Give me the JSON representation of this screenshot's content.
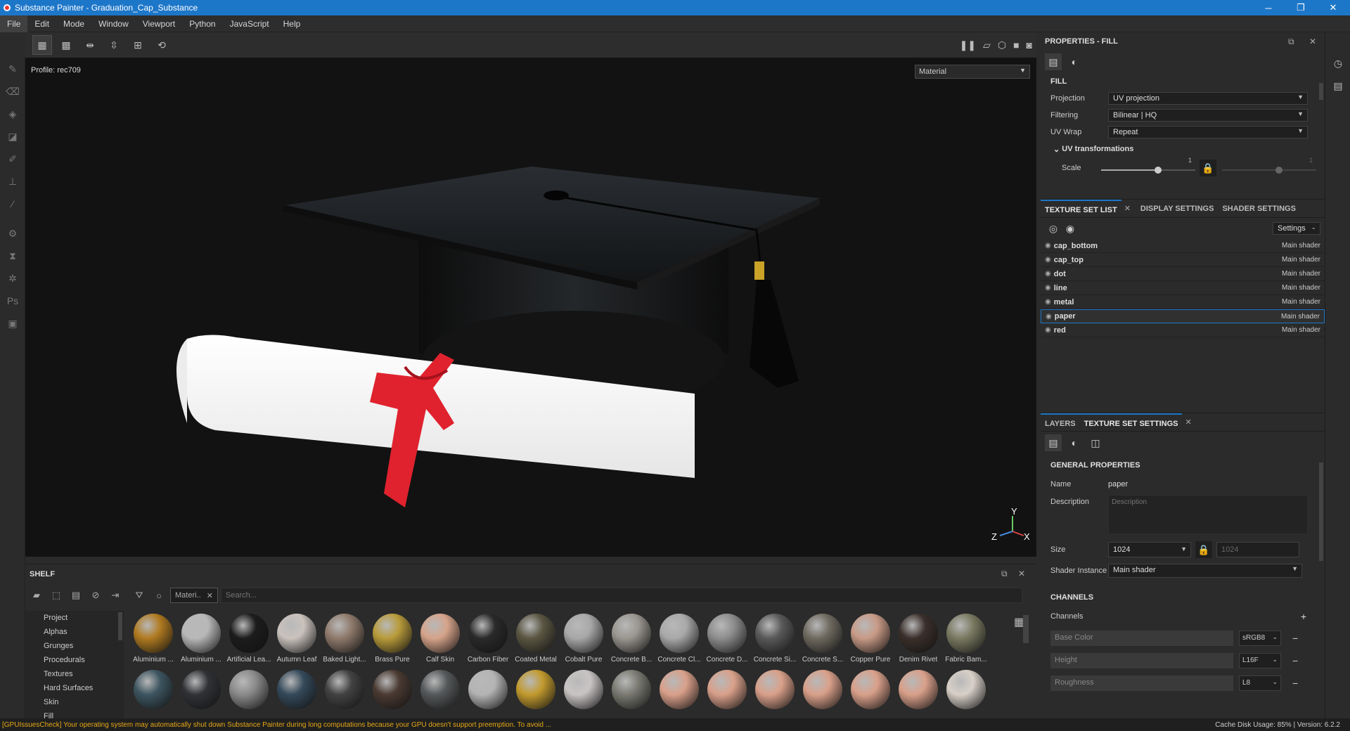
{
  "window": {
    "title": "Substance Painter - Graduation_Cap_Substance",
    "minimize": "─",
    "maximize": "❐",
    "close": "✕"
  },
  "menu": [
    "File",
    "Edit",
    "Mode",
    "Window",
    "Viewport",
    "Python",
    "JavaScript",
    "Help"
  ],
  "viewport": {
    "profile": "Profile: rec709",
    "mode": "Material",
    "axes": {
      "y": "Y",
      "x": "X",
      "z": "Z"
    }
  },
  "properties": {
    "title": "PROPERTIES - FILL",
    "section": "FILL",
    "projection_label": "Projection",
    "projection": "UV projection",
    "filtering_label": "Filtering",
    "filtering": "Bilinear | HQ",
    "uvwrap_label": "UV Wrap",
    "uvwrap": "Repeat",
    "uvtrans": "UV transformations",
    "scale_label": "Scale",
    "scale_value": "1",
    "scale_value2": "1"
  },
  "texture_set_list": {
    "tabs": [
      "TEXTURE SET LIST",
      "DISPLAY SETTINGS",
      "SHADER SETTINGS"
    ],
    "settings": "Settings",
    "items": [
      {
        "name": "cap_bottom",
        "shader": "Main shader"
      },
      {
        "name": "cap_top",
        "shader": "Main shader"
      },
      {
        "name": "dot",
        "shader": "Main shader"
      },
      {
        "name": "line",
        "shader": "Main shader"
      },
      {
        "name": "metal",
        "shader": "Main shader"
      },
      {
        "name": "paper",
        "shader": "Main shader"
      },
      {
        "name": "red",
        "shader": "Main shader"
      }
    ],
    "selected_index": 5
  },
  "tss": {
    "tabs": [
      "LAYERS",
      "TEXTURE SET SETTINGS"
    ],
    "general": "GENERAL PROPERTIES",
    "name_label": "Name",
    "name": "paper",
    "desc_label": "Description",
    "desc_placeholder": "Description",
    "size_label": "Size",
    "size": "1024",
    "size2": "1024",
    "shader_label": "Shader Instance",
    "shader": "Main shader",
    "channels_title": "CHANNELS",
    "channels_label": "Channels",
    "channels": [
      {
        "name": "Base Color",
        "format": "sRGB8"
      },
      {
        "name": "Height",
        "format": "L16F"
      },
      {
        "name": "Roughness",
        "format": "L8"
      }
    ]
  },
  "shelf": {
    "title": "SHELF",
    "filter_tag": "Materi..",
    "search_placeholder": "Search...",
    "categories": [
      "Project",
      "Alphas",
      "Grunges",
      "Procedurals",
      "Textures",
      "Hard Surfaces",
      "Skin",
      "Fill"
    ],
    "materials_row1": [
      {
        "name": "Aluminium ...",
        "color": "#b07a20"
      },
      {
        "name": "Aluminium ...",
        "color": "#b8b8b8"
      },
      {
        "name": "Artificial Lea...",
        "color": "#1c1c1c"
      },
      {
        "name": "Autumn Leaf",
        "color": "#c9c2bd"
      },
      {
        "name": "Baked Light...",
        "color": "#8f7a6c"
      },
      {
        "name": "Brass Pure",
        "color": "#b89b3a"
      },
      {
        "name": "Calf Skin",
        "color": "#d6a38a"
      },
      {
        "name": "Carbon Fiber",
        "color": "#2a2a2a"
      },
      {
        "name": "Coated Metal",
        "color": "#5a5642"
      },
      {
        "name": "Cobalt Pure",
        "color": "#a8a8a8"
      },
      {
        "name": "Concrete B...",
        "color": "#9a9690"
      },
      {
        "name": "Concrete Cl...",
        "color": "#a9a9a9"
      },
      {
        "name": "Concrete D...",
        "color": "#8d8d8d"
      },
      {
        "name": "Concrete Si...",
        "color": "#595959"
      },
      {
        "name": "Concrete S...",
        "color": "#6f6a60"
      },
      {
        "name": "Copper Pure",
        "color": "#c89a86"
      },
      {
        "name": "Denim Rivet",
        "color": "#3a2f2a"
      },
      {
        "name": "Fabric Bam...",
        "color": "#7a7a62"
      }
    ],
    "materials_row2": [
      {
        "name": "",
        "color": "#3d5560"
      },
      {
        "name": "",
        "color": "#303236"
      },
      {
        "name": "",
        "color": "#8a8a8a"
      },
      {
        "name": "",
        "color": "#34495a"
      },
      {
        "name": "",
        "color": "#424242"
      },
      {
        "name": "",
        "color": "#4a3a32"
      },
      {
        "name": "",
        "color": "#55585a"
      },
      {
        "name": "",
        "color": "#b4b4b4"
      },
      {
        "name": "",
        "color": "#c29a2e"
      },
      {
        "name": "",
        "color": "#c9c4c4"
      },
      {
        "name": "",
        "color": "#7a7a72"
      },
      {
        "name": "",
        "color": "#d9a08a"
      },
      {
        "name": "",
        "color": "#d9a08a"
      },
      {
        "name": "",
        "color": "#d9a08a"
      },
      {
        "name": "",
        "color": "#d9a08a"
      },
      {
        "name": "",
        "color": "#d9a08a"
      },
      {
        "name": "",
        "color": "#d9a08a"
      },
      {
        "name": "",
        "color": "#d8d0c8"
      }
    ]
  },
  "status": {
    "warning": "[GPUIssuesCheck] Your operating system may automatically shut down Substance Painter during long computations because your GPU doesn't support preemption. To avoid ...",
    "cache": "Cache Disk Usage:   85% | Version: 6.2.2"
  },
  "colors": {
    "accent": "#1d77c9",
    "warning": "#e6a817"
  }
}
